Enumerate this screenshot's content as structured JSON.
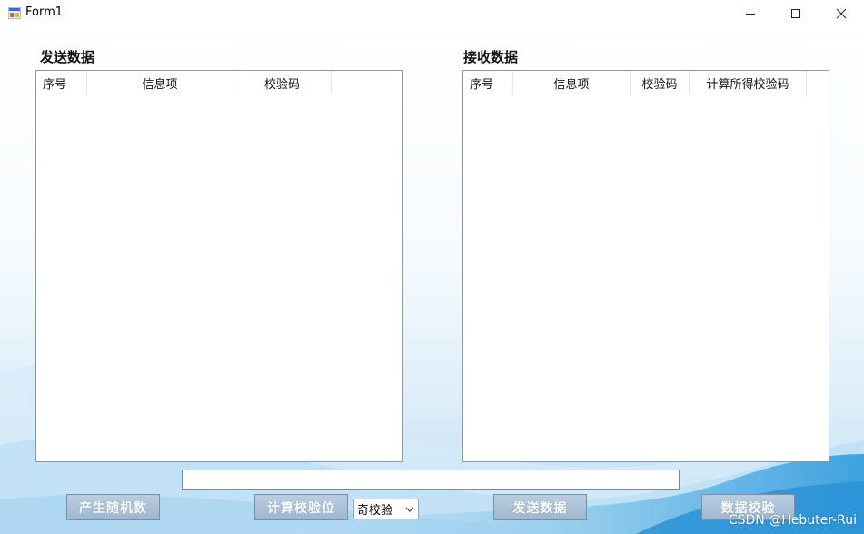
{
  "window": {
    "title": "Form1",
    "icon": "winforms-app-icon",
    "controls": [
      "minimize-icon",
      "maximize-icon",
      "close-icon"
    ]
  },
  "send_panel": {
    "label": "发送数据",
    "columns": [
      "序号",
      "信息项",
      "校验码",
      ""
    ]
  },
  "receive_panel": {
    "label": "接收数据",
    "columns": [
      "序号",
      "信息项",
      "校验码",
      "计算所得校验码",
      ""
    ]
  },
  "input": {
    "value": ""
  },
  "buttons": {
    "random": "产生随机数",
    "compute": "计算校验位",
    "send": "发送数据",
    "verify": "数据校验"
  },
  "parity_select": {
    "value": "奇校验"
  },
  "watermark": "CSDN @Hebuter-Rui",
  "colors": {
    "background_top": "#ffffff",
    "background_wave": "#3aa6e0",
    "button_fill": "#a9c1d8",
    "button_text": "#ffffff"
  }
}
